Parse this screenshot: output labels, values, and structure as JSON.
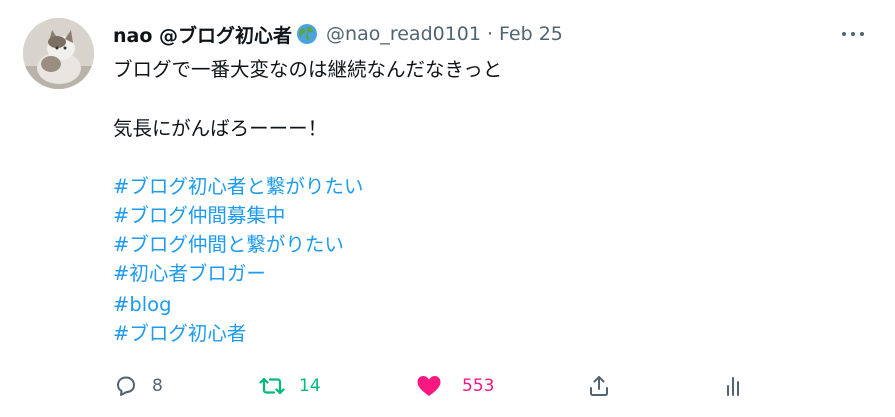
{
  "user": {
    "display_name": "nao @ブログ初心者",
    "handle": "@nao_read0101",
    "separator": "·",
    "date": "Feb 25"
  },
  "tweet": {
    "lines": [
      "ブログで一番大変なのは継続なんだなきっと",
      "気長にがんばろーーー！"
    ],
    "hashtags": [
      "#ブログ初心者と繋がりたい",
      "#ブログ仲間募集中",
      "#ブログ仲間と繋がりたい",
      "#初心者ブロガー",
      "#blog",
      "#ブログ初心者"
    ]
  },
  "actions": {
    "reply_count": "8",
    "retweet_count": "14",
    "like_count": "553"
  },
  "colors": {
    "link": "#1d9bf0",
    "retweet": "#00ba7c",
    "like": "#f91880",
    "muted": "#536471"
  },
  "icons": [
    "avatar",
    "globe-icon",
    "more-icon",
    "reply-icon",
    "retweet-icon",
    "heart-icon",
    "share-icon",
    "analytics-icon"
  ]
}
